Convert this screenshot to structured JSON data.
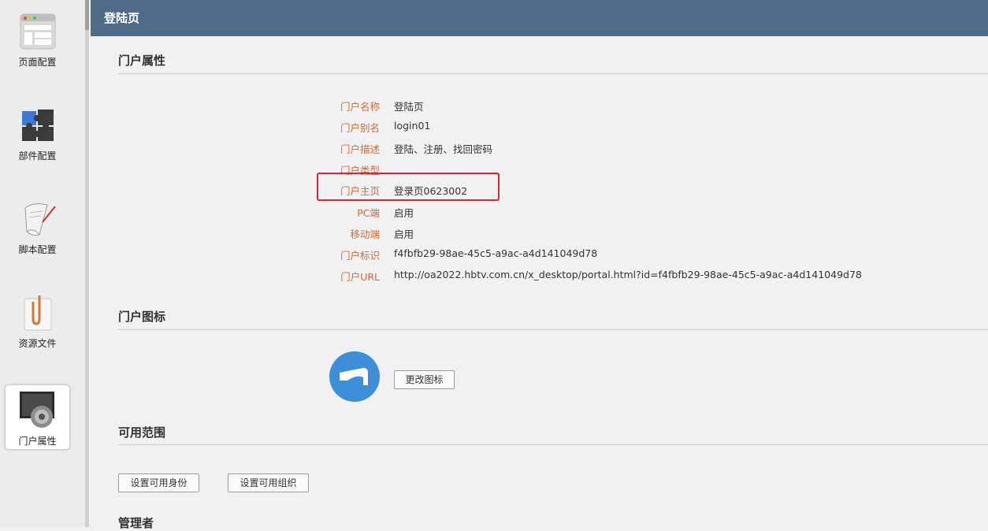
{
  "sidebar": {
    "items": [
      {
        "label": "页面配置",
        "icon": "page-layout-icon"
      },
      {
        "label": "部件配置",
        "icon": "puzzle-icon"
      },
      {
        "label": "脚本配置",
        "icon": "script-scroll-icon"
      },
      {
        "label": "资源文件",
        "icon": "paperclip-file-icon"
      },
      {
        "label": "门户属性",
        "icon": "settings-gear-icon",
        "active": true
      }
    ]
  },
  "header": {
    "title": "登陆页"
  },
  "sections": {
    "properties": {
      "title": "门户属性",
      "rows": [
        {
          "label": "门户名称",
          "value": "登陆页"
        },
        {
          "label": "门户别名",
          "value": "login01"
        },
        {
          "label": "门户描述",
          "value": "登陆、注册、找回密码"
        },
        {
          "label": "门户类型",
          "value": ""
        },
        {
          "label": "门户主页",
          "value": "登录页0623002"
        },
        {
          "label": "PC端",
          "value": "启用"
        },
        {
          "label": "移动端",
          "value": "启用"
        },
        {
          "label": "门户标识",
          "value": "f4fbfb29-98ae-45c5-a9ac-a4d141049d78"
        },
        {
          "label": "门户URL",
          "value": "http://oa2022.hbtv.com.cn/x_desktop/portal.html?id=f4fbfb29-98ae-45c5-a9ac-a4d141049d78"
        }
      ]
    },
    "icon": {
      "title": "门户图标",
      "change_button": "更改图标"
    },
    "scope": {
      "title": "可用范围",
      "identity_button": "设置可用身份",
      "org_button": "设置可用组织"
    },
    "admins": {
      "title": "管理者"
    }
  },
  "colors": {
    "header": "#4e6b88",
    "label": "#cc6d3b",
    "highlight": "#e0262d",
    "portal_icon": "#3d8fd9"
  }
}
